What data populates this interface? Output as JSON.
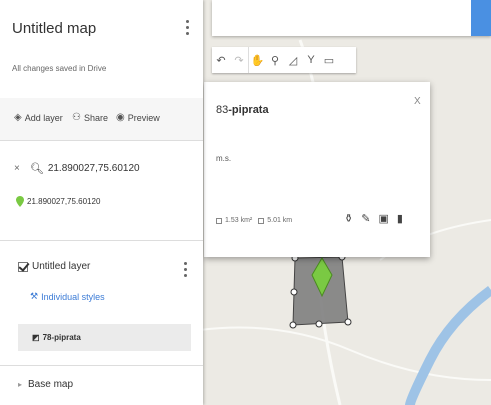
{
  "panel": {
    "title": "Untitled map",
    "saved_status": "All changes saved in Drive",
    "toolbar": {
      "add_layer": "Add layer",
      "share": "Share",
      "preview": "Preview"
    },
    "search_result": "21.890027,75.60120",
    "pin_label": "21.890027,75.60120",
    "layer": {
      "name": "Untitled layer",
      "styles_link": "Individual styles",
      "feature": "78-piprata"
    },
    "base_map": "Base map"
  },
  "popup": {
    "number": "83",
    "name": "-piprata",
    "description": "m.s.",
    "area": "1.53 km²",
    "perimeter": "5.01 km"
  },
  "colors": {
    "link": "#3b7bd6",
    "pin": "#7ac943",
    "polygon": "#808080",
    "river": "#9ec3e6",
    "search_button": "#4a90e2"
  }
}
